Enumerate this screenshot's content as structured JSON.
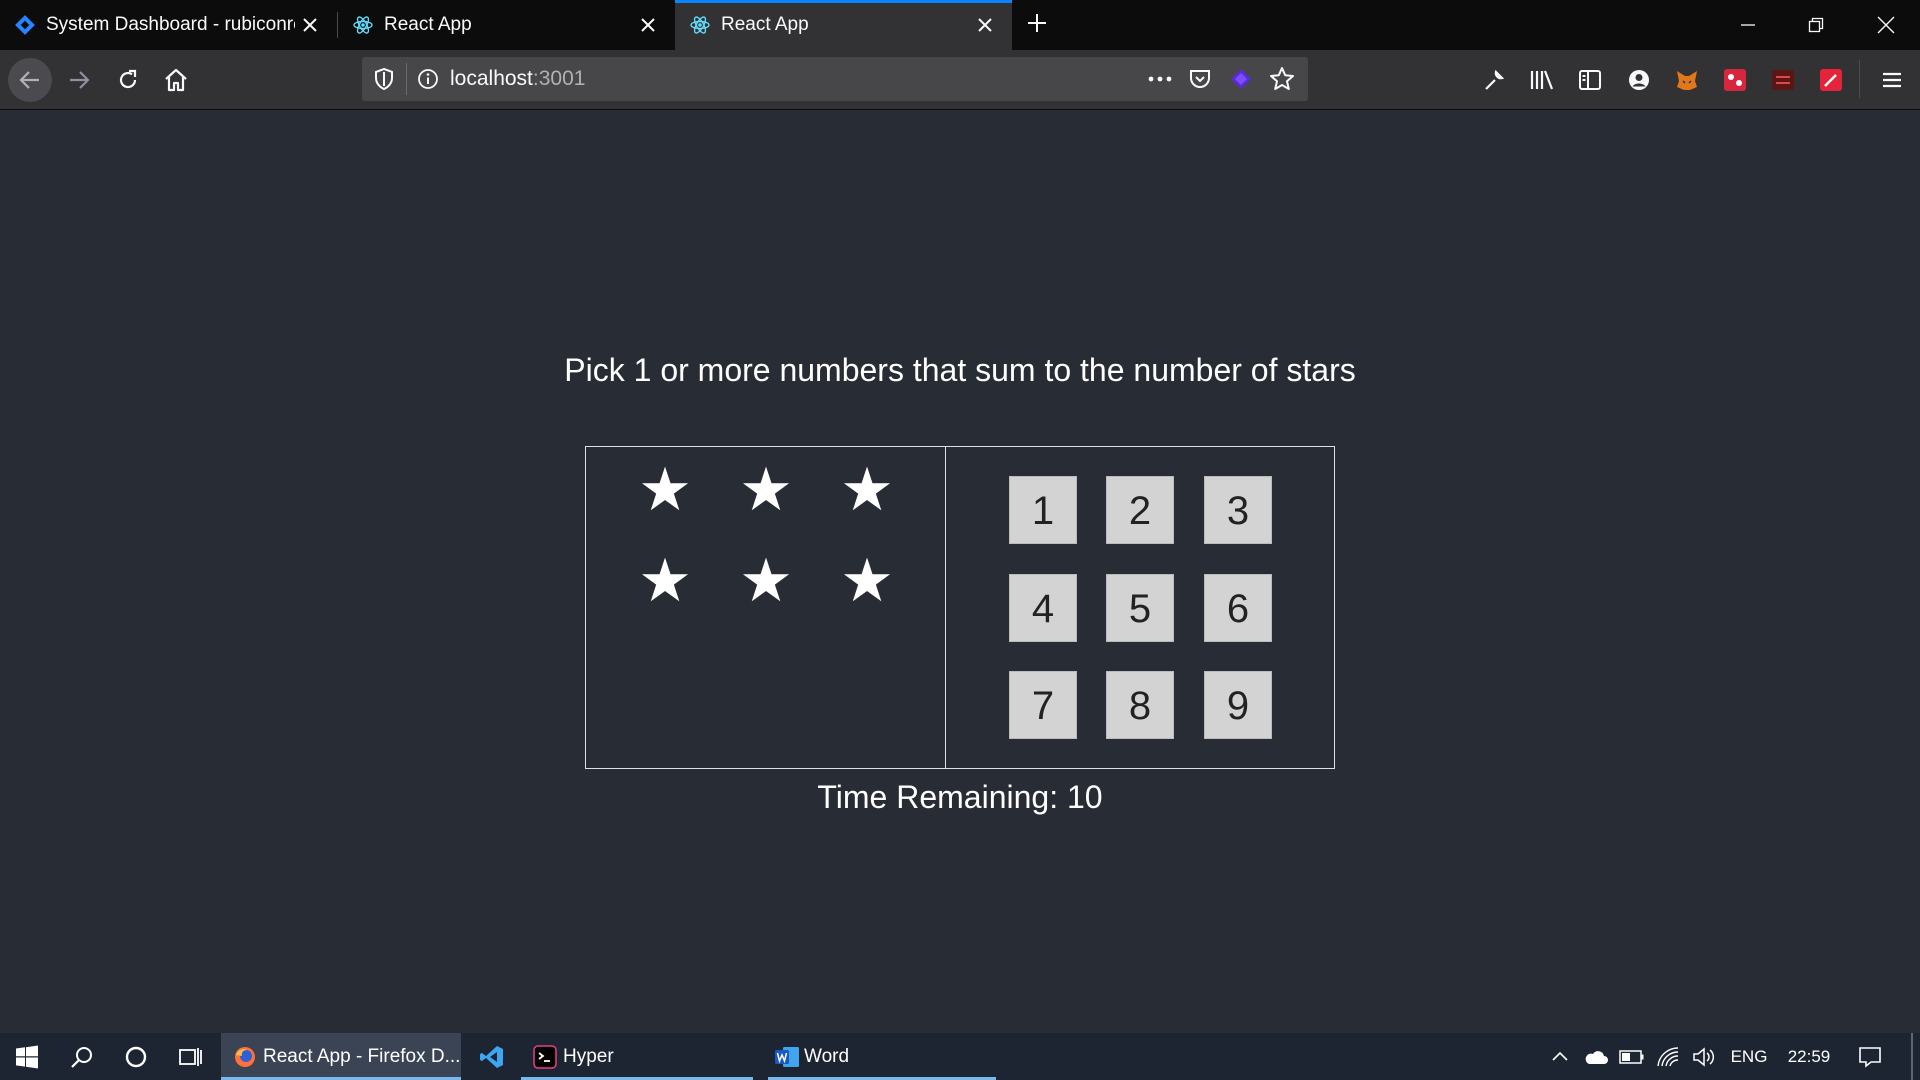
{
  "browser": {
    "tabs": [
      {
        "title": "System Dashboard - rubiconred",
        "icon": "diamond-icon"
      },
      {
        "title": "React App",
        "icon": "react-icon"
      },
      {
        "title": "React App",
        "icon": "react-icon",
        "active": true
      }
    ],
    "new_tab_icon": "plus-icon",
    "url_host": "localhost",
    "url_port": ":3001",
    "accent_color": "#0a84ff"
  },
  "game": {
    "help_text": "Pick 1 or more numbers that sum to the number of stars",
    "star_count": 6,
    "numbers": [
      "1",
      "2",
      "3",
      "4",
      "5",
      "6",
      "7",
      "8",
      "9"
    ],
    "timer_label": "Time Remaining: ",
    "timer_value": "10",
    "background_color": "#282c34"
  },
  "taskbar": {
    "apps": [
      {
        "label": "React App - Firefox D...",
        "icon": "firefox-icon",
        "active": true
      },
      {
        "label": "",
        "icon": "vscode-icon"
      },
      {
        "label": "Hyper",
        "icon": "hyper-icon"
      },
      {
        "label": "Word",
        "icon": "word-icon"
      }
    ],
    "language": "ENG",
    "time": "22:59"
  }
}
